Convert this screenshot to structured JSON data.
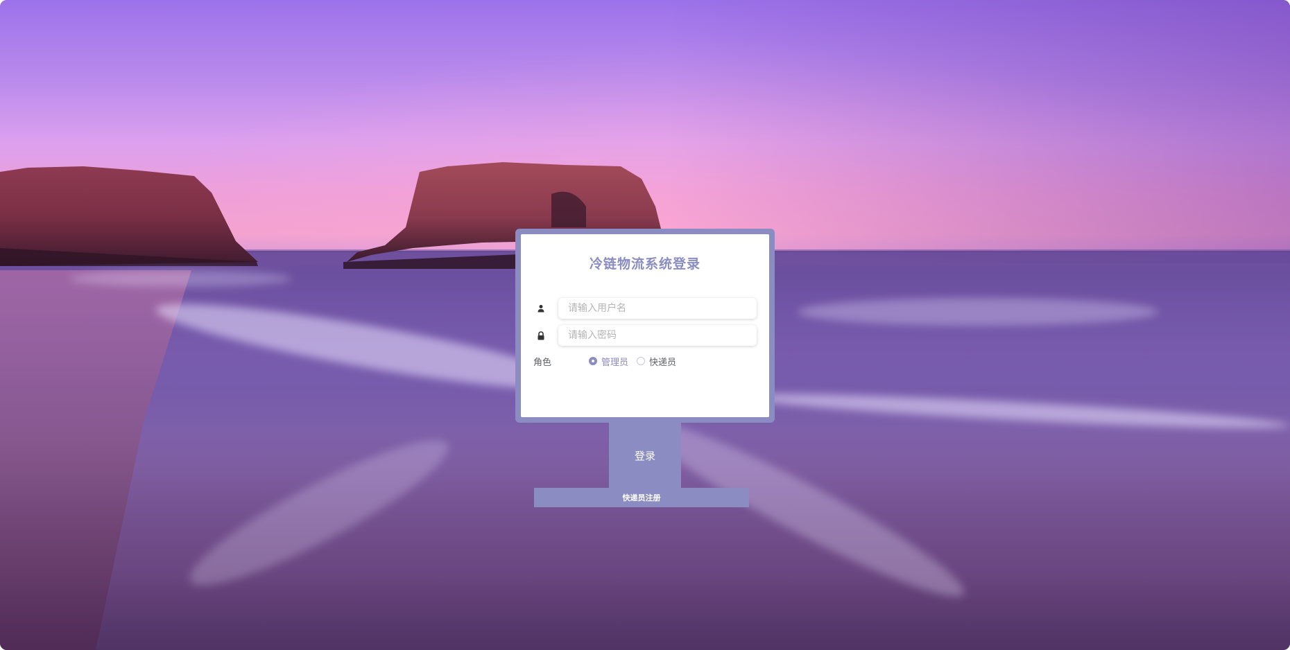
{
  "login": {
    "title": "冷链物流系统登录",
    "username": {
      "icon": "user-icon",
      "placeholder": "请输入用户名",
      "value": ""
    },
    "password": {
      "icon": "lock-icon",
      "placeholder": "请输入密码",
      "value": ""
    },
    "role": {
      "label": "角色",
      "options": [
        {
          "label": "管理员",
          "checked": true
        },
        {
          "label": "快递员",
          "checked": false
        }
      ]
    },
    "submit_label": "登录",
    "register_label": "快递员注册"
  },
  "colors": {
    "accent": "#8a8cc2",
    "card_background": "#ffffff"
  }
}
